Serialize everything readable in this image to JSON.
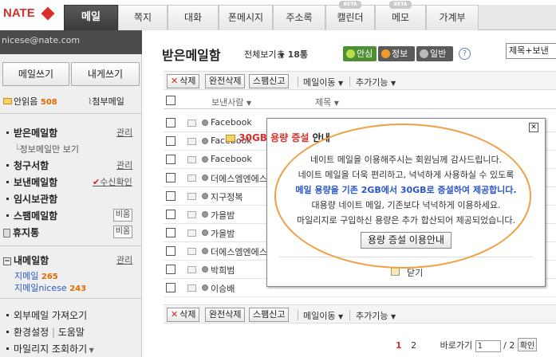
{
  "brand": {
    "logo": "NATE"
  },
  "nav": {
    "tabs": [
      {
        "label": "메일",
        "active": true
      },
      {
        "label": "쪽지"
      },
      {
        "label": "대화"
      },
      {
        "label": "폰메시지"
      },
      {
        "label": "주소록"
      },
      {
        "label": "캘린더",
        "badge": "BETA"
      },
      {
        "label": "메모",
        "badge": "BETA"
      },
      {
        "label": "가계부"
      }
    ]
  },
  "sidebar": {
    "account": "nicese@nate.com",
    "write_button": "메일쓰기",
    "self_button": "내게쓰기",
    "unread_label": "안읽음",
    "unread_count": "508",
    "attach_label": "첨부메일",
    "inbox": "받은메일함",
    "inbox_manage": "관리",
    "inbox_sub": "정보메일만 보기",
    "billing": "청구서함",
    "billing_manage": "관리",
    "sent": "보낸메일함",
    "sent_check": "수신확인",
    "temp": "임시보관함",
    "spam": "스팸메일함",
    "spam_btn": "비움",
    "trash": "휴지통",
    "trash_btn": "비움",
    "my": "내메일함",
    "my_manage": "관리",
    "folders": [
      {
        "name": "지메일",
        "count": "265"
      },
      {
        "name": "지메일nicese",
        "count": "243"
      }
    ],
    "external": "외부메일 가져오기",
    "settings": "환경설정",
    "help": "도움말",
    "mileage": "마일리지 조회하기"
  },
  "main": {
    "title": "받은메일함",
    "view_all": "전체보기",
    "total_prefix": "총",
    "total": "18통",
    "filters": [
      {
        "label": "안심",
        "bg": "#4e8f36",
        "dot": "#b6e04a"
      },
      {
        "label": "정보",
        "bg": "#5a5a5a",
        "dot": "#f49a2a"
      },
      {
        "label": "일반",
        "bg": "#5a5a5a",
        "dot": "#bbbbbb"
      }
    ],
    "help": "?",
    "search_select": "제목+보낸",
    "toolbar": {
      "delete": "삭제",
      "full_delete": "완전삭제",
      "spam": "스팸신고",
      "move": "메일이동",
      "more": "추가기능"
    },
    "col_sender": "보낸사람",
    "col_subject": "제목",
    "rows": [
      {
        "sender": "Facebook"
      },
      {
        "sender": "Facebook"
      },
      {
        "sender": "Facebook"
      },
      {
        "sender": "더에스엠엔에스"
      },
      {
        "sender": "지구정복"
      },
      {
        "sender": "가을밤"
      },
      {
        "sender": "가을밤"
      },
      {
        "sender": "더에스엠엔에스"
      },
      {
        "sender": "박희범"
      },
      {
        "sender": "이승배"
      }
    ],
    "pager": {
      "current": "1",
      "next": "2",
      "goto_label": "바로가기",
      "goto_value": "1",
      "total": "/ 2",
      "confirm": "확인"
    }
  },
  "modal": {
    "title_highlight": "30GB 용량 증설",
    "title_rest": "안내",
    "line1": "네이트 메일을 이용해주시는 회원님께 감사드립니다.",
    "line2": "네이트 메일을 더욱 편리하고, 넉넉하게 사용하실 수 있도록",
    "line3": "메일 용량을 기존 2GB에서 30GB로 증설하여 제공합니다.",
    "line4": "대용량 네이트 메일, 기존보다 넉넉하게 이용하세요.",
    "line5": "마일리지로 구입하신 용량은 추가 합산되어 제공되었습니다.",
    "button": "용량 증설 이용안내",
    "close": "닫기"
  }
}
